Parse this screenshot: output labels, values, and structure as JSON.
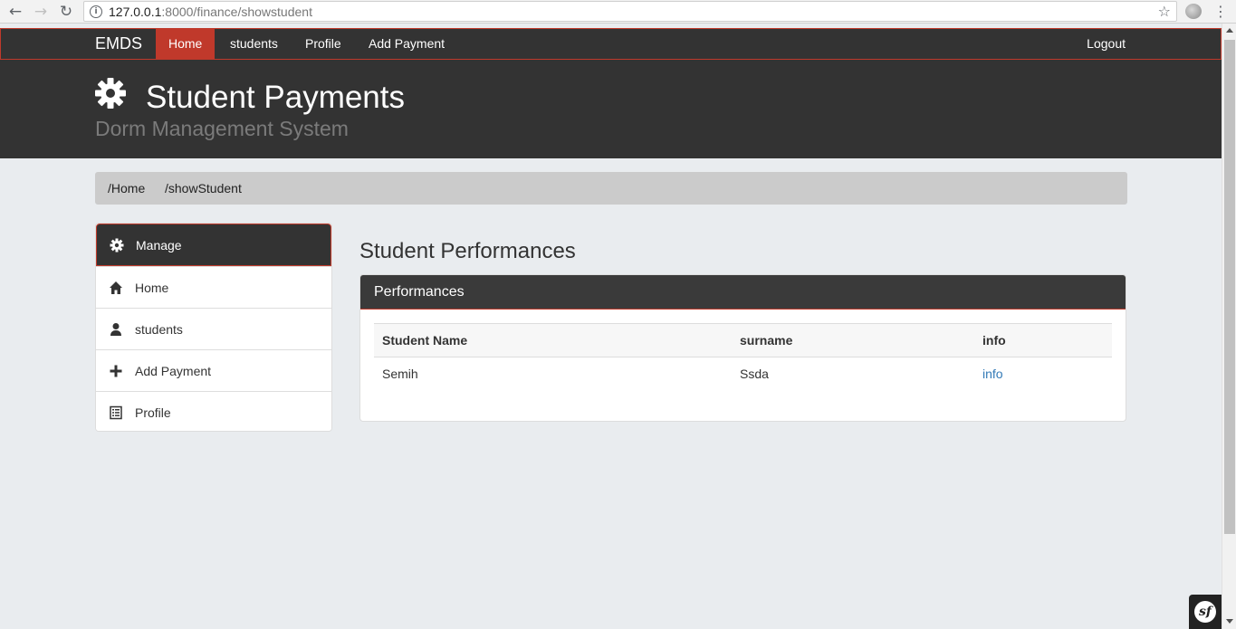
{
  "browser": {
    "url_host": "127.0.0.1",
    "url_rest": ":8000/finance/showstudent"
  },
  "navbar": {
    "brand": "EMDS",
    "items": [
      {
        "label": "Home",
        "active": true
      },
      {
        "label": "students"
      },
      {
        "label": "Profile"
      },
      {
        "label": "Add Payment"
      }
    ],
    "logout": "Logout"
  },
  "header": {
    "title": "Student Payments",
    "subtitle": "Dorm Management System",
    "icon": "gear-icon"
  },
  "breadcrumb": [
    "/Home",
    "/showStudent"
  ],
  "sidebar": {
    "title": "Manage",
    "items": [
      {
        "label": "Home",
        "icon": "home-icon"
      },
      {
        "label": "students",
        "icon": "user-icon"
      },
      {
        "label": "Add Payment",
        "icon": "plus-icon"
      },
      {
        "label": "Profile",
        "icon": "list-icon"
      }
    ]
  },
  "main": {
    "title": "Student Performances",
    "panel_title": "Performances",
    "table": {
      "headers": [
        "Student Name",
        "surname",
        "info"
      ],
      "rows": [
        [
          "Semih",
          "Ssda",
          "info"
        ]
      ]
    }
  },
  "colors": {
    "accent": "#c0392b",
    "dark": "#333333",
    "link": "#337ab7"
  }
}
